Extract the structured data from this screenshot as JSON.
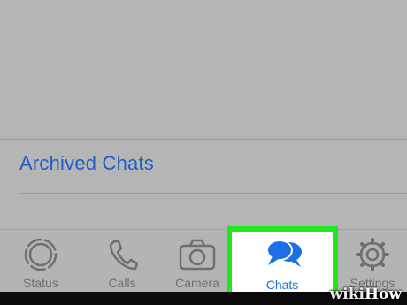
{
  "list": {
    "archived_label": "Archived Chats"
  },
  "tabbar": {
    "tabs": [
      {
        "label": "Status",
        "icon": "status-icon"
      },
      {
        "label": "Calls",
        "icon": "phone-icon"
      },
      {
        "label": "Camera",
        "icon": "camera-icon"
      },
      {
        "label": "Chats",
        "icon": "chats-icon",
        "selected": true
      },
      {
        "label": "Settings",
        "icon": "gear-icon"
      }
    ]
  },
  "colors": {
    "background": "#b5b5b5",
    "accent": "#1d6fe6",
    "highlight_border": "#21e81e",
    "inactive": "#6f6f6f"
  },
  "watermark": {
    "wiki": "wiki",
    "how": "How"
  }
}
